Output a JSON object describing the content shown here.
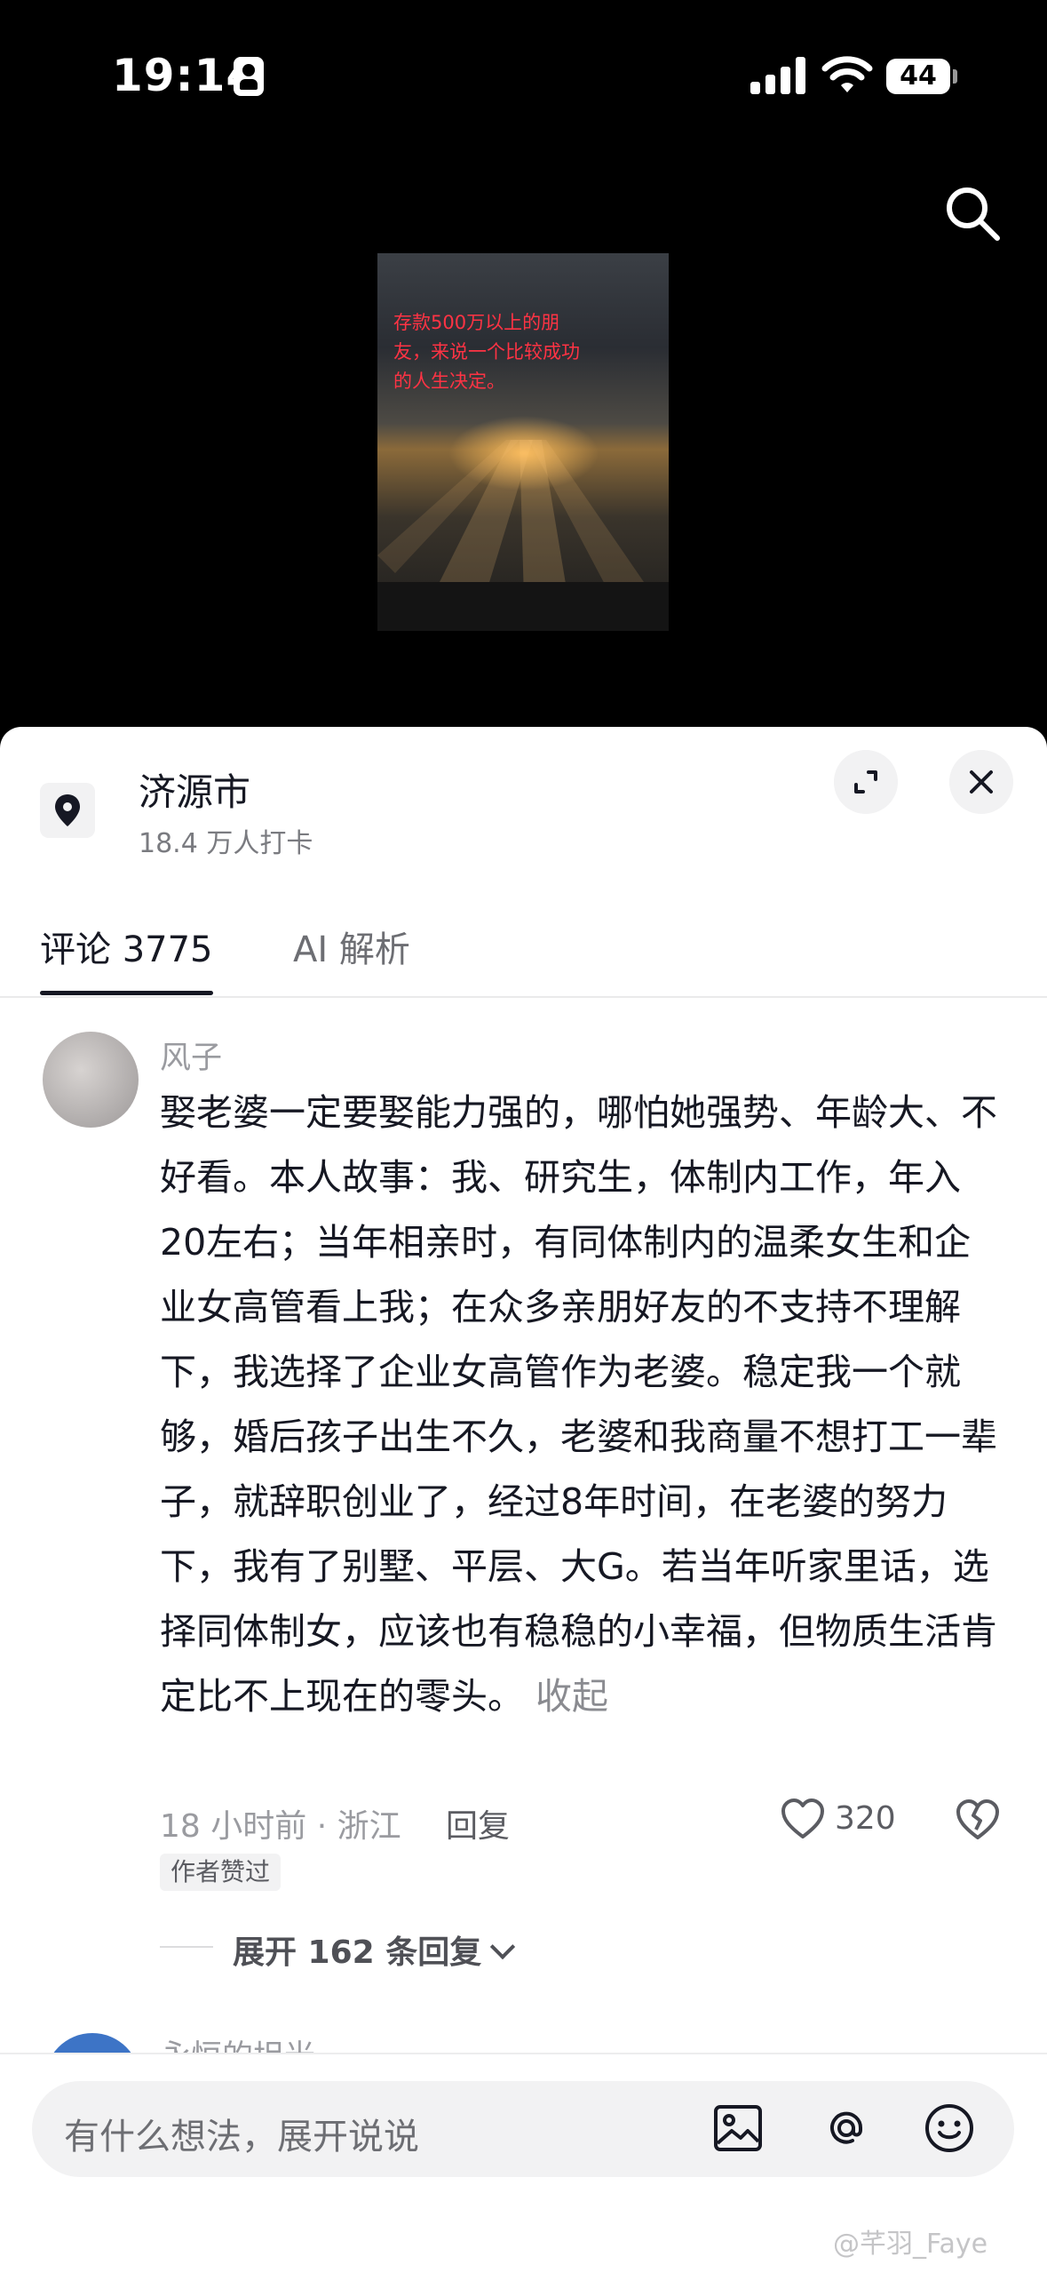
{
  "status_bar": {
    "time": "19:14",
    "battery": "44"
  },
  "media": {
    "overlay_text": "存款500万以上的朋友，来说一个比较成功的人生决定。"
  },
  "location": {
    "name": "济源市",
    "checkins": "18.4 万人打卡"
  },
  "tabs": [
    {
      "label": "评论 3775"
    },
    {
      "label": "AI 解析"
    }
  ],
  "comment": {
    "username": "风子",
    "text": "娶老婆一定要娶能力强的，哪怕她强势、年龄大、不好看。本人故事：我、研究生，体制内工作，年入20左右；当年相亲时，有同体制内的温柔女生和企业女高管看上我；在众多亲朋好友的不支持不理解下，我选择了企业女高管作为老婆。稳定我一个就够，婚后孩子出生不久，老婆和我商量不想打工一辈子，就辞职创业了，经过8年时间，在老婆的努力下，我有了别墅、平层、大G。若当年听家里话，选择同体制女，应该也有稳稳的小幸福，但物质生活肯定比不上现在的零头。",
    "collapse_label": "收起",
    "meta": "18 小时前 · 浙江",
    "reply_label": "回复",
    "likes": "320",
    "author_liked": "作者赞过",
    "expand_replies": "展开 162 条回复"
  },
  "next_comment": {
    "username": "永恒的坦光"
  },
  "input": {
    "placeholder": "有什么想法，展开说说"
  },
  "watermark": "@芊羽_Faye",
  "colors": {
    "accent_text": "#161823",
    "muted_text": "#9a9ba0",
    "overlay_red": "#ff3344"
  },
  "icons": {
    "location": "map-pin-icon",
    "search": "search-icon",
    "expand": "expand-icon",
    "close": "close-icon",
    "like": "heart-icon",
    "dislike": "broken-heart-icon",
    "image": "image-icon",
    "at": "at-icon",
    "emoji": "emoji-icon"
  }
}
